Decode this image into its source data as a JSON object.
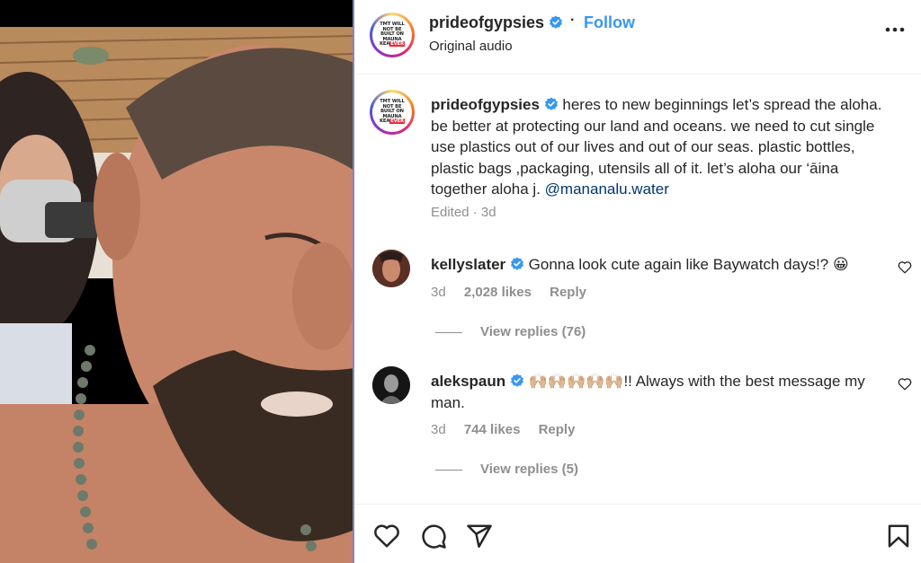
{
  "post": {
    "username": "prideofgypsies",
    "follow_label": "Follow",
    "separator": "·",
    "audio": "Original audio",
    "avatar_text": {
      "line1": "TMT WILL",
      "line2": "NOT BE",
      "line3": "BUILT ON",
      "line4": "MAUNA",
      "line5": "KEA",
      "badge": "EVER"
    },
    "caption": "heres to new beginnings let’s spread the aloha. be better at protecting our land and oceans. we need to cut single use plastics out of our lives and out of our seas. plastic bottles, plastic bags ,packaging, utensils all of it. let’s aloha our ‘āina together aloha j.",
    "mention": "@mananalu.water",
    "edited": "Edited",
    "meta_sep": "·",
    "age": "3d"
  },
  "comments": [
    {
      "username": "kellyslater",
      "text": "Gonna look cute again like Baywatch days!? 😀",
      "age": "3d",
      "likes": "2,028 likes",
      "reply_label": "Reply",
      "view_replies": "View replies (76)"
    },
    {
      "username": "alekspaun",
      "text": "🙌🏼🙌🏼🙌🏼🙌🏼🙌🏼!! Always with the best message my man.",
      "age": "3d",
      "likes": "744 likes",
      "reply_label": "Reply",
      "view_replies": "View replies (5)"
    }
  ],
  "icons": {
    "verified": "verified-badge-icon",
    "more": "more-options-icon",
    "heart": "heart-icon",
    "comment": "comment-icon",
    "share": "share-icon",
    "save": "bookmark-icon"
  },
  "colors": {
    "link": "#3897f0",
    "mention": "#00376b",
    "muted": "#8e8e8e",
    "verified": "#3897f0"
  }
}
